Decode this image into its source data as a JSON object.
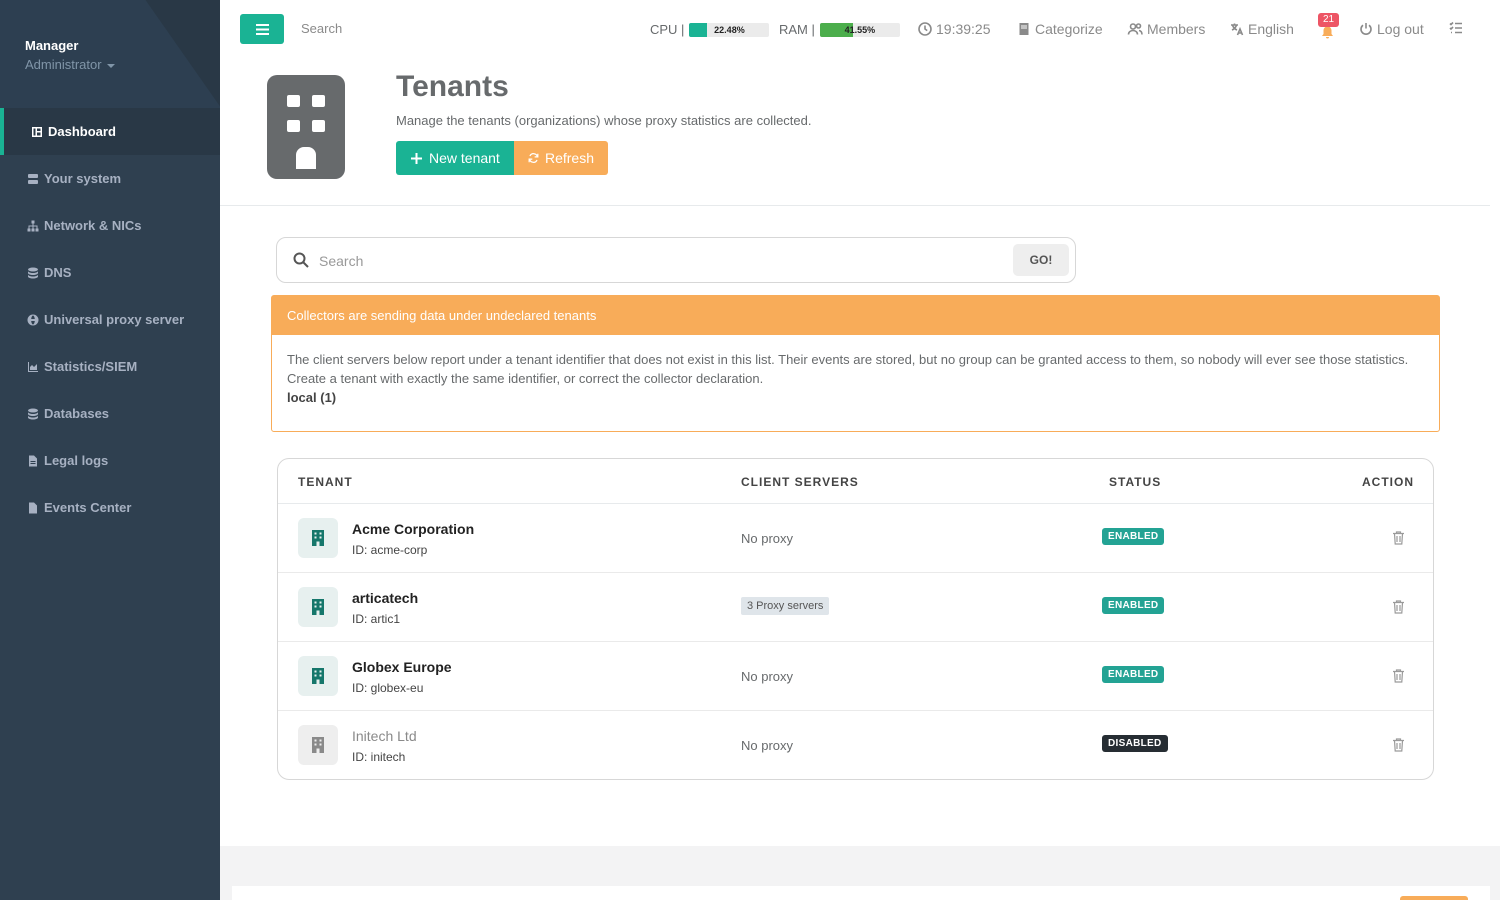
{
  "sidebar": {
    "profile": {
      "name": "Manager",
      "role": "Administrator"
    },
    "items": [
      {
        "label": "Dashboard",
        "icon": "dashboard-icon",
        "active": true
      },
      {
        "label": "Your system",
        "icon": "server-icon"
      },
      {
        "label": "Network & NICs",
        "icon": "network-icon"
      },
      {
        "label": "DNS",
        "icon": "database-icon"
      },
      {
        "label": "Universal proxy server",
        "icon": "globe-icon"
      },
      {
        "label": "Statistics/SIEM",
        "icon": "area-chart-icon"
      },
      {
        "label": "Databases",
        "icon": "database-icon"
      },
      {
        "label": "Legal logs",
        "icon": "file-icon"
      },
      {
        "label": "Events Center",
        "icon": "file-icon"
      }
    ]
  },
  "topbar": {
    "search_placeholder": "Search",
    "cpu": {
      "label": "CPU |",
      "percent": 22.48,
      "text": "22.48%"
    },
    "ram": {
      "label": "RAM |",
      "percent": 41.55,
      "text": "41.55%"
    },
    "clock": "19:39:25",
    "categorize": "Categorize",
    "members": "Members",
    "language": "English",
    "notifications": "21",
    "logout": "Log out"
  },
  "heading": {
    "title": "Tenants",
    "description": "Manage the tenants (organizations) whose proxy statistics are collected.",
    "new_button": "New tenant",
    "refresh_button": "Refresh"
  },
  "search": {
    "placeholder": "Search",
    "go_label": "GO!"
  },
  "alert": {
    "title": "Collectors are sending data under undeclared tenants",
    "line1": "The client servers below report under a tenant identifier that does not exist in this list. Their events are stored, but no group can be granted access to them, so nobody will ever see those statistics.",
    "line2": "Create a tenant with exactly the same identifier, or correct the collector declaration.",
    "entry": "local (1)"
  },
  "table": {
    "headers": {
      "tenant": "TENANT",
      "client_servers": "CLIENT SERVERS",
      "status": "STATUS",
      "action": "ACTION"
    },
    "rows": [
      {
        "name": "Acme Corporation",
        "id": "ID: acme-corp",
        "client_servers": "No proxy",
        "has_chip": false,
        "status": "ENABLED",
        "enabled": true
      },
      {
        "name": "articatech",
        "id": "ID: artic1",
        "client_servers": "3 Proxy servers",
        "has_chip": true,
        "status": "ENABLED",
        "enabled": true
      },
      {
        "name": "Globex Europe",
        "id": "ID: globex-eu",
        "client_servers": "No proxy",
        "has_chip": false,
        "status": "ENABLED",
        "enabled": true
      },
      {
        "name": "Initech Ltd",
        "id": "ID: initech",
        "client_servers": "No proxy",
        "has_chip": false,
        "status": "DISABLED",
        "enabled": false
      }
    ]
  },
  "colors": {
    "primary": "#1ab394",
    "warning": "#f8ac59",
    "sidebar": "#2f4050",
    "danger": "#ed5565",
    "enabled_badge": "#23a394",
    "disabled_badge": "#262d33"
  }
}
